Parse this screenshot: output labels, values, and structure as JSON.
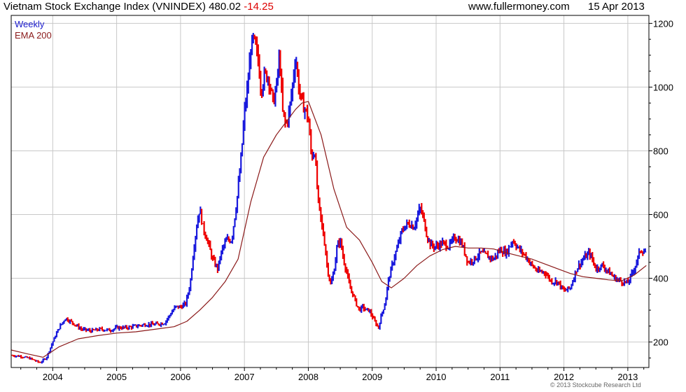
{
  "header": {
    "title": "Vietnam Stock Exchange Index (VNINDEX) 480.02",
    "change": "-14.25",
    "website": "www.fullermoney.com",
    "date": "15 Apr 2013"
  },
  "legend": {
    "weekly_label": "Weekly",
    "ema_label": "EMA 200"
  },
  "credit": "© 2013 Stockcube Research Ltd",
  "colors": {
    "up_bar": "#1a1add",
    "down_bar": "#ee0000",
    "ema_line": "#8b1a1a",
    "grid": "#c8c8c8",
    "axis": "#000000"
  },
  "chart_data": {
    "type": "line",
    "title": "Vietnam Stock Exchange Index (VNINDEX) 480.02 -14.25",
    "xlabel": "",
    "ylabel": "",
    "xlim": [
      2003.35,
      2013.33
    ],
    "ylim": [
      120,
      1225
    ],
    "y_ticks": [
      200,
      400,
      600,
      800,
      1000,
      1200
    ],
    "x_ticks": [
      {
        "label": "2004",
        "value": 2004
      },
      {
        "label": "2005",
        "value": 2005
      },
      {
        "label": "2006",
        "value": 2006
      },
      {
        "label": "2007",
        "value": 2007
      },
      {
        "label": "2008",
        "value": 2008
      },
      {
        "label": "2009",
        "value": 2009
      },
      {
        "label": "2010",
        "value": 2010
      },
      {
        "label": "2011",
        "value": 2011
      },
      {
        "label": "2012",
        "value": 2012
      },
      {
        "label": "2013",
        "value": 2013
      }
    ],
    "grid": true,
    "y_axis_side": "right",
    "legend_position": "top-left",
    "series": [
      {
        "name": "Weekly",
        "style": "ohlc-bars",
        "x": [
          2003.35,
          2003.5,
          2003.65,
          2003.8,
          2003.9,
          2004.0,
          2004.1,
          2004.2,
          2004.3,
          2004.45,
          2004.6,
          2004.75,
          2004.9,
          2005.0,
          2005.15,
          2005.3,
          2005.45,
          2005.6,
          2005.75,
          2005.85,
          2005.92,
          2006.0,
          2006.08,
          2006.15,
          2006.2,
          2006.25,
          2006.3,
          2006.35,
          2006.42,
          2006.5,
          2006.58,
          2006.65,
          2006.72,
          2006.8,
          2006.88,
          2006.95,
          2007.0,
          2007.05,
          2007.1,
          2007.14,
          2007.18,
          2007.22,
          2007.26,
          2007.32,
          2007.38,
          2007.45,
          2007.5,
          2007.55,
          2007.6,
          2007.65,
          2007.7,
          2007.75,
          2007.8,
          2007.85,
          2007.9,
          2007.95,
          2008.0,
          2008.05,
          2008.1,
          2008.15,
          2008.2,
          2008.25,
          2008.3,
          2008.35,
          2008.4,
          2008.45,
          2008.5,
          2008.55,
          2008.6,
          2008.65,
          2008.7,
          2008.75,
          2008.8,
          2008.85,
          2008.9,
          2008.95,
          2009.0,
          2009.05,
          2009.1,
          2009.15,
          2009.2,
          2009.25,
          2009.3,
          2009.35,
          2009.4,
          2009.45,
          2009.5,
          2009.55,
          2009.6,
          2009.65,
          2009.7,
          2009.75,
          2009.8,
          2009.85,
          2009.9,
          2009.95,
          2010.0,
          2010.1,
          2010.2,
          2010.3,
          2010.4,
          2010.5,
          2010.6,
          2010.7,
          2010.8,
          2010.9,
          2011.0,
          2011.1,
          2011.2,
          2011.3,
          2011.4,
          2011.5,
          2011.6,
          2011.7,
          2011.8,
          2011.9,
          2012.0,
          2012.1,
          2012.2,
          2012.3,
          2012.4,
          2012.5,
          2012.6,
          2012.7,
          2012.8,
          2012.9,
          2013.0,
          2013.1,
          2013.2,
          2013.29
        ],
        "values": [
          158,
          155,
          148,
          135,
          150,
          200,
          245,
          275,
          262,
          240,
          235,
          240,
          237,
          245,
          245,
          250,
          255,
          255,
          260,
          290,
          310,
          310,
          320,
          380,
          480,
          560,
          620,
          560,
          520,
          460,
          430,
          490,
          520,
          520,
          640,
          780,
          920,
          1000,
          1120,
          1150,
          1120,
          1080,
          990,
          1040,
          1030,
          950,
          1000,
          1100,
          920,
          880,
          920,
          1000,
          1100,
          1000,
          950,
          930,
          900,
          780,
          800,
          650,
          580,
          520,
          430,
          380,
          420,
          500,
          520,
          460,
          420,
          370,
          350,
          320,
          300,
          310,
          300,
          300,
          280,
          260,
          245,
          290,
          320,
          390,
          430,
          470,
          500,
          540,
          560,
          570,
          570,
          560,
          590,
          620,
          590,
          540,
          510,
          500,
          500,
          510,
          500,
          530,
          510,
          450,
          460,
          480,
          470,
          460,
          490,
          480,
          520,
          490,
          470,
          440,
          420,
          420,
          390,
          390,
          360,
          370,
          430,
          460,
          480,
          430,
          440,
          420,
          400,
          390,
          385,
          430,
          490,
          480
        ]
      },
      {
        "name": "EMA 200",
        "style": "line",
        "x": [
          2003.35,
          2003.6,
          2003.85,
          2004.1,
          2004.4,
          2004.7,
          2005.0,
          2005.3,
          2005.6,
          2005.9,
          2006.1,
          2006.3,
          2006.5,
          2006.7,
          2006.9,
          2007.1,
          2007.3,
          2007.5,
          2007.65,
          2007.8,
          2007.9,
          2008.0,
          2008.2,
          2008.4,
          2008.6,
          2008.8,
          2009.0,
          2009.15,
          2009.3,
          2009.5,
          2009.7,
          2009.9,
          2010.1,
          2010.3,
          2010.5,
          2010.7,
          2010.9,
          2011.1,
          2011.3,
          2011.5,
          2011.7,
          2011.9,
          2012.1,
          2012.3,
          2012.5,
          2012.7,
          2012.9,
          2013.1,
          2013.29
        ],
        "values": [
          175,
          163,
          152,
          185,
          210,
          220,
          228,
          232,
          240,
          248,
          265,
          300,
          340,
          390,
          460,
          640,
          780,
          850,
          890,
          930,
          950,
          955,
          850,
          680,
          560,
          520,
          450,
          390,
          370,
          400,
          440,
          470,
          490,
          500,
          495,
          495,
          492,
          480,
          470,
          460,
          445,
          430,
          415,
          405,
          400,
          395,
          392,
          410,
          440
        ]
      }
    ]
  }
}
